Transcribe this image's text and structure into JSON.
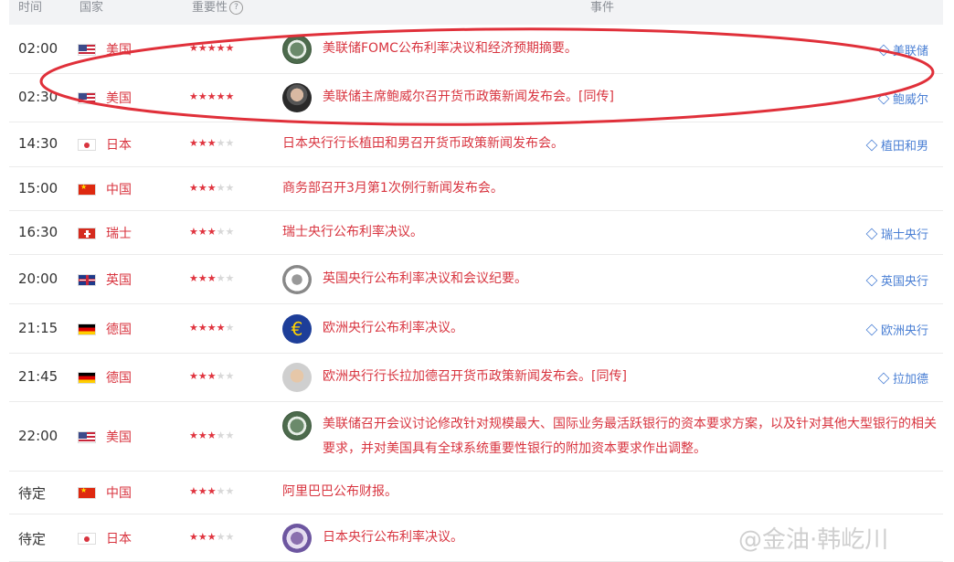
{
  "header": {
    "time": "时间",
    "country": "国家",
    "importance": "重要性",
    "help": "?",
    "event": "事件"
  },
  "rows": [
    {
      "time": "02:00",
      "flag": "us",
      "country": "美国",
      "stars": 5,
      "logo": "fed",
      "event": "美联储FOMC公布利率决议和经济预期摘要。",
      "tag": "美联储"
    },
    {
      "time": "02:30",
      "flag": "us",
      "country": "美国",
      "stars": 5,
      "logo": "powell",
      "event": "美联储主席鲍威尔召开货币政策新闻发布会。[同传]",
      "tag": "鲍威尔"
    },
    {
      "time": "14:30",
      "flag": "jp",
      "country": "日本",
      "stars": 3,
      "logo": "",
      "event": "日本央行行长植田和男召开货币政策新闻发布会。",
      "tag": "植田和男"
    },
    {
      "time": "15:00",
      "flag": "cn",
      "country": "中国",
      "stars": 3,
      "logo": "",
      "event": "商务部召开3月第1次例行新闻发布会。",
      "tag": ""
    },
    {
      "time": "16:30",
      "flag": "ch",
      "country": "瑞士",
      "stars": 3,
      "logo": "",
      "event": "瑞士央行公布利率决议。",
      "tag": "瑞士央行"
    },
    {
      "time": "20:00",
      "flag": "gb",
      "country": "英国",
      "stars": 3,
      "logo": "boe",
      "event": "英国央行公布利率决议和会议纪要。",
      "tag": "英国央行"
    },
    {
      "time": "21:15",
      "flag": "de",
      "country": "德国",
      "stars": 4,
      "logo": "ecb",
      "event": "欧洲央行公布利率决议。",
      "tag": "欧洲央行"
    },
    {
      "time": "21:45",
      "flag": "de",
      "country": "德国",
      "stars": 3,
      "logo": "lagarde",
      "event": "欧洲央行行长拉加德召开货币政策新闻发布会。[同传]",
      "tag": "拉加德"
    },
    {
      "time": "22:00",
      "flag": "us",
      "country": "美国",
      "stars": 3,
      "logo": "fed",
      "event": "美联储召开会议讨论修改针对规模最大、国际业务最活跃银行的资本要求方案，以及针对其他大型银行的相关要求，并对美国具有全球系统重要性银行的附加资本要求作出调整。",
      "tag": ""
    },
    {
      "time": "待定",
      "flag": "cn",
      "country": "中国",
      "stars": 3,
      "logo": "",
      "event": "阿里巴巴公布财报。",
      "tag": ""
    },
    {
      "time": "待定",
      "flag": "jp",
      "country": "日本",
      "stars": 3,
      "logo": "boj",
      "event": "日本央行公布利率决议。",
      "tag": ""
    }
  ],
  "ecb_symbol": "€",
  "watermark": "@金油·韩屹川",
  "colors": {
    "accent": "#d8343f",
    "link": "#4a7fd4",
    "annotation": "#e0303a",
    "header_bg": "#f2f3f5"
  }
}
